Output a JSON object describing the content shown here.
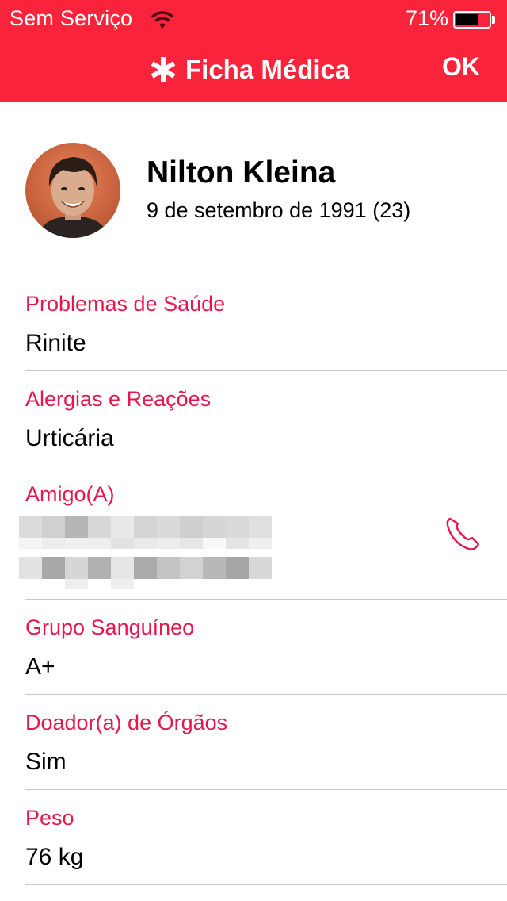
{
  "status_bar": {
    "carrier": "Sem Serviço",
    "battery_percent": "71%",
    "battery_level": 0.71
  },
  "header": {
    "title": "Ficha Médica",
    "ok_label": "OK",
    "background_color": "#f9233c"
  },
  "profile": {
    "name": "Nilton Kleina",
    "dob": "9 de setembro de 1991 (23)"
  },
  "fields": [
    {
      "label": "Problemas de Saúde",
      "value": "Rinite"
    },
    {
      "label": "Alergias e Reações",
      "value": "Urticária"
    },
    {
      "label": "Amigo(A)",
      "value": ""
    },
    {
      "label": "Grupo Sanguíneo",
      "value": "A+"
    },
    {
      "label": "Doador(a) de Órgãos",
      "value": "Sim"
    },
    {
      "label": "Peso",
      "value": "76 kg"
    }
  ],
  "colors": {
    "accent": "#e8164f",
    "divider": "#c8c7cc"
  },
  "icons": {
    "title_icon": "medical-asterisk-icon",
    "contact_call": "phone-icon",
    "signal": "wifi-icon",
    "battery": "battery-icon"
  }
}
